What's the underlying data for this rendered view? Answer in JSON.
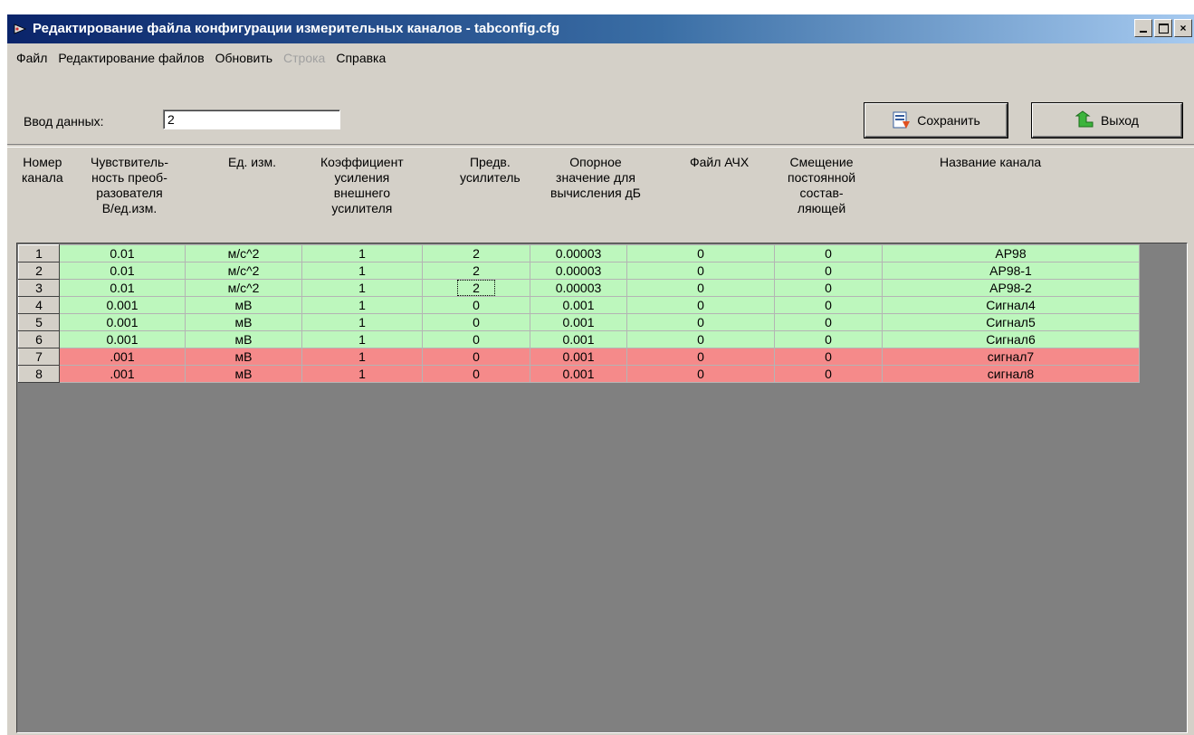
{
  "window": {
    "title": "Редактирование файла конфигурации измерительных каналов - tabconfig.cfg",
    "controls": [
      "_",
      "□",
      "×"
    ]
  },
  "menu": [
    {
      "label": "Файл",
      "enabled": true
    },
    {
      "label": "Редактирование файлов",
      "enabled": true
    },
    {
      "label": "Обновить",
      "enabled": true
    },
    {
      "label": "Строка",
      "enabled": false
    },
    {
      "label": "Справка",
      "enabled": true
    }
  ],
  "input": {
    "label": "Ввод данных:",
    "value": "2"
  },
  "buttons": {
    "save": "Сохранить",
    "exit": "Выход"
  },
  "columns": [
    "Номер\nканала",
    "Чувствитель-\nность преоб-\nразователя\nВ/ед.изм.",
    "Ед. изм.",
    "Коэффициент\nусиления\nвнешнего\nусилителя",
    "Предв.\nусилитель",
    "Опорное\nзначение для\nвычисления дБ",
    "Файл АЧХ",
    "Смещение\nпостоянной\nсостав-\nляющей",
    "Название канала"
  ],
  "rows": [
    {
      "num": "1",
      "sens": "0.01",
      "unit": "м/с^2",
      "gain": "1",
      "preamp": "2",
      "ref": "0.00003",
      "afc": "0",
      "offset": "0",
      "name": "AP98",
      "status": "ok"
    },
    {
      "num": "2",
      "sens": "0.01",
      "unit": "м/с^2",
      "gain": "1",
      "preamp": "2",
      "ref": "0.00003",
      "afc": "0",
      "offset": "0",
      "name": "AP98-1",
      "status": "ok"
    },
    {
      "num": "3",
      "sens": "0.01",
      "unit": "м/с^2",
      "gain": "1",
      "preamp": "2",
      "ref": "0.00003",
      "afc": "0",
      "offset": "0",
      "name": "AP98-2",
      "status": "ok",
      "focus": "preamp"
    },
    {
      "num": "4",
      "sens": "0.001",
      "unit": "мВ",
      "gain": "1",
      "preamp": "0",
      "ref": "0.001",
      "afc": "0",
      "offset": "0",
      "name": "Сигнал4",
      "status": "ok"
    },
    {
      "num": "5",
      "sens": "0.001",
      "unit": "мВ",
      "gain": "1",
      "preamp": "0",
      "ref": "0.001",
      "afc": "0",
      "offset": "0",
      "name": "Сигнал5",
      "status": "ok"
    },
    {
      "num": "6",
      "sens": "0.001",
      "unit": "мВ",
      "gain": "1",
      "preamp": "0",
      "ref": "0.001",
      "afc": "0",
      "offset": "0",
      "name": "Сигнал6",
      "status": "ok"
    },
    {
      "num": "7",
      "sens": ".001",
      "unit": "мВ",
      "gain": "1",
      "preamp": "0",
      "ref": "0.001",
      "afc": "0",
      "offset": "0",
      "name": "сигнал7",
      "status": "bad"
    },
    {
      "num": "8",
      "sens": ".001",
      "unit": "мВ",
      "gain": "1",
      "preamp": "0",
      "ref": "0.001",
      "afc": "0",
      "offset": "0",
      "name": "сигнал8",
      "status": "bad"
    }
  ],
  "colors": {
    "ok_row": "#bdf7bd",
    "bad_row": "#f58a8a",
    "grid_bg": "#808080"
  }
}
